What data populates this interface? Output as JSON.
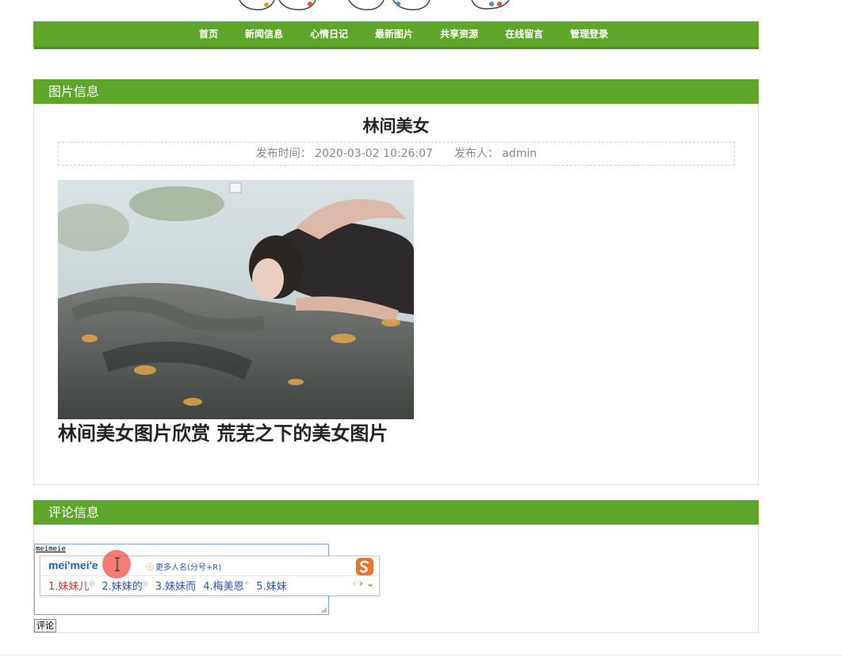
{
  "nav": {
    "items": [
      "首页",
      "新闻信息",
      "心情日记",
      "最新图片",
      "共享资源",
      "在线留言",
      "管理登录"
    ]
  },
  "photo_panel": {
    "title": "图片信息",
    "post_title": "林间美女",
    "publish_label": "发布时间：",
    "publish_time": "2020-03-02 10:26:07",
    "author_label": "发布人：",
    "author": "admin",
    "caption": "林间美女图片欣赏 荒芜之下的美女图片"
  },
  "comment_panel": {
    "title": "评论信息",
    "input_value": "meimeie",
    "submit_label": "评论"
  },
  "ime": {
    "pinyin": "mei'mei'e",
    "hint": "更多人名(分号+R)",
    "candidates": [
      "1.妹妹儿",
      "2.妹妹的",
      "3.妹妹而",
      "4.梅美恩",
      "5.妹妹"
    ]
  },
  "colors": {
    "accent_green": "#5ea62a",
    "ime_blue": "#2a55b0",
    "ime_first": "#c0392b",
    "click_marker": "#f05046"
  }
}
